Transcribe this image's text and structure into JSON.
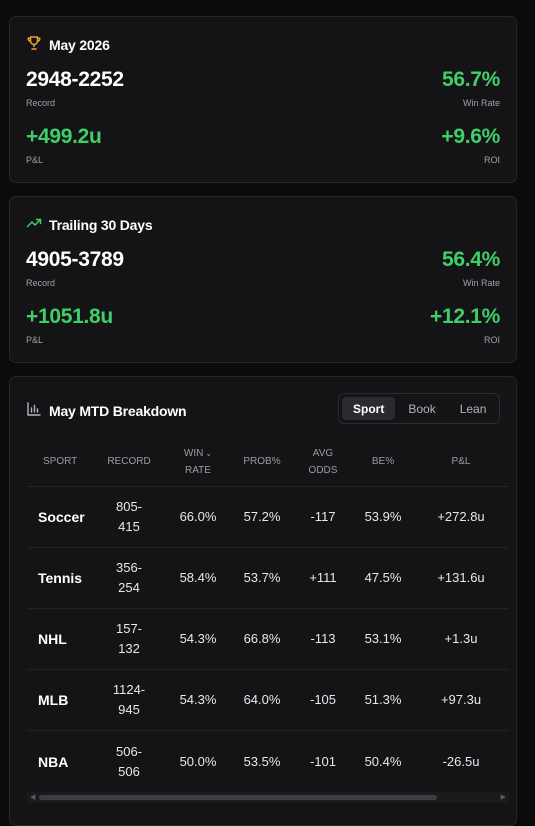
{
  "month_card": {
    "title": "May 2026",
    "icon": "trophy-icon",
    "record": "2948-2252",
    "record_label": "Record",
    "win_rate": "56.7%",
    "win_rate_label": "Win Rate",
    "pl": "+499.2u",
    "pl_label": "P&L",
    "roi": "+9.6%",
    "roi_label": "ROI"
  },
  "trailing_card": {
    "title": "Trailing 30 Days",
    "icon": "trending-up-icon",
    "record": "4905-3789",
    "record_label": "Record",
    "win_rate": "56.4%",
    "win_rate_label": "Win Rate",
    "pl": "+1051.8u",
    "pl_label": "P&L",
    "roi": "+12.1%",
    "roi_label": "ROI"
  },
  "breakdown": {
    "title": "May MTD Breakdown",
    "icon": "bar-chart-icon",
    "tabs": [
      "Sport",
      "Book",
      "Lean"
    ],
    "active_tab": "Sport",
    "columns": {
      "sport": "SPORT",
      "record": "RECORD",
      "win_rate_1": "WIN",
      "win_rate_2": "RATE",
      "prob": "PROB%",
      "avg_odds_1": "AVG",
      "avg_odds_2": "ODDS",
      "be": "BE%",
      "pl": "P&L"
    },
    "rows": [
      {
        "sport": "Soccer",
        "record_1": "805-",
        "record_2": "415",
        "win_rate": "66.0%",
        "prob": "57.2%",
        "avg_odds": "-117",
        "be": "53.9%",
        "pl": "+272.8u"
      },
      {
        "sport": "Tennis",
        "record_1": "356-",
        "record_2": "254",
        "win_rate": "58.4%",
        "prob": "53.7%",
        "avg_odds": "+111",
        "be": "47.5%",
        "pl": "+131.6u"
      },
      {
        "sport": "NHL",
        "record_1": "157-",
        "record_2": "132",
        "win_rate": "54.3%",
        "prob": "66.8%",
        "avg_odds": "-113",
        "be": "53.1%",
        "pl": "+1.3u"
      },
      {
        "sport": "MLB",
        "record_1": "1124-",
        "record_2": "945",
        "win_rate": "54.3%",
        "prob": "64.0%",
        "avg_odds": "-105",
        "be": "51.3%",
        "pl": "+97.3u"
      },
      {
        "sport": "NBA",
        "record_1": "506-",
        "record_2": "506",
        "win_rate": "50.0%",
        "prob": "53.5%",
        "avg_odds": "-101",
        "be": "50.4%",
        "pl": "-26.5u"
      }
    ]
  },
  "colors": {
    "positive": "#3fcf6a",
    "caution": "#f0a032",
    "negative": "#ee4a4a",
    "background": "#0b0b0c",
    "card": "#141416"
  }
}
